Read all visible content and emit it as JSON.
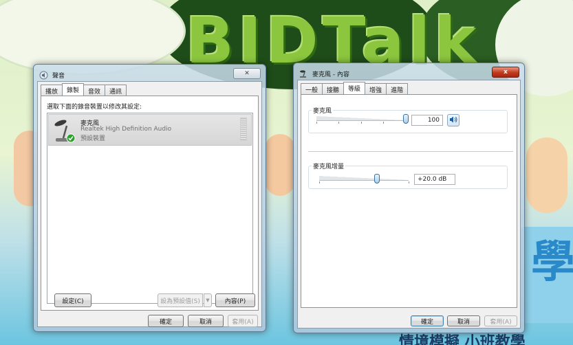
{
  "background": {
    "title_text": "BIDTalk",
    "subtitle_text": "情境模擬 小班教學",
    "big_char": "學"
  },
  "sound_dialog": {
    "title": "聲音",
    "close_glyph": "✕",
    "tabs": [
      "播放",
      "錄製",
      "音效",
      "通訊"
    ],
    "active_tab": "錄製",
    "instruction": "選取下面的錄音裝置以修改其設定:",
    "device": {
      "name": "麥克風",
      "driver": "Realtek High Definition Audio",
      "status": "預設裝置"
    },
    "buttons": {
      "configure": "設定(C)",
      "set_default": "設為預設值(S)",
      "properties": "內容(P)",
      "ok": "確定",
      "cancel": "取消",
      "apply": "套用(A)"
    }
  },
  "mic_properties": {
    "title": "麥克風 - 內容",
    "close_glyph": "x",
    "tabs": [
      "一般",
      "接聽",
      "等級",
      "增強",
      "進階"
    ],
    "active_tab": "等級",
    "microphone_group": "麥克風",
    "microphone_level": "100",
    "microphone_level_value": 100,
    "boost_group": "麥克風增量",
    "boost_value": "+20.0 dB",
    "boost_value_number": 20.0,
    "buttons": {
      "ok": "確定",
      "cancel": "取消",
      "apply": "套用(A)"
    }
  },
  "colors": {
    "accent": "#3c7fb1",
    "status_green": "#2ea12e"
  }
}
